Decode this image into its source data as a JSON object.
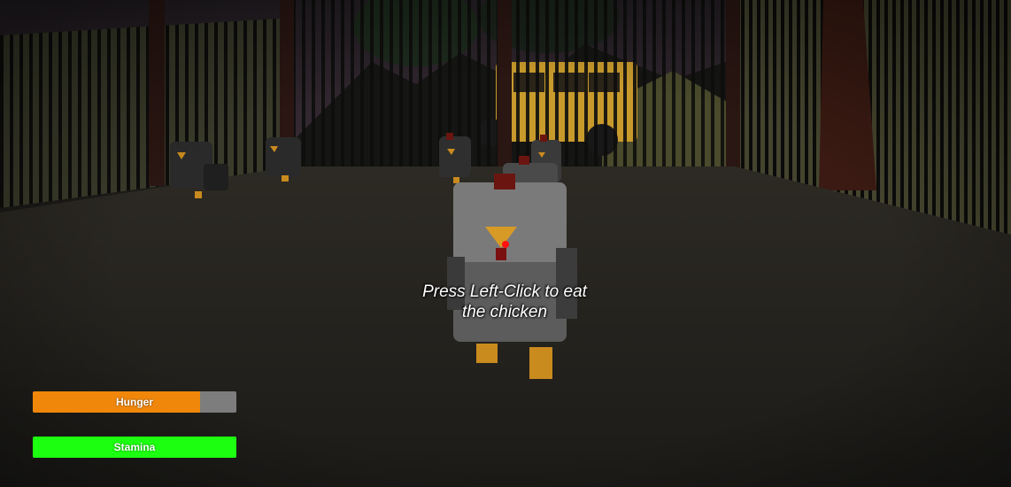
{
  "hud": {
    "prompt_line1": "Press Left-Click to eat",
    "prompt_line2": "the chicken",
    "hunger": {
      "label": "Hunger",
      "level": 0.82,
      "color": "#f0870a",
      "track_color": "#7d7d7d"
    },
    "stamina": {
      "label": "Stamina",
      "level": 1.0,
      "color": "#1cff10",
      "track_color": "#7d7d7d"
    }
  }
}
